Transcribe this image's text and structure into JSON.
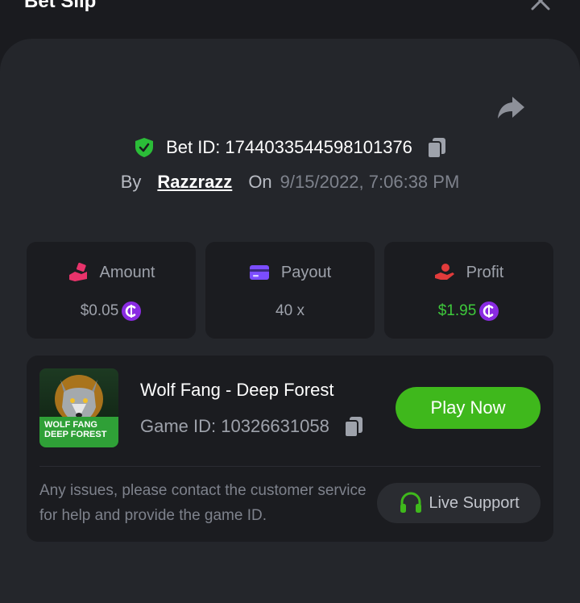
{
  "header": {
    "title": "Bet Slip",
    "close_icon": "close-icon"
  },
  "bet": {
    "id_text": "Bet ID: 1744033544598101376",
    "by_label": "By",
    "username": "Razzrazz",
    "on_label": "On",
    "date": "9/15/2022, 7:06:38 PM"
  },
  "stats": {
    "amount": {
      "label": "Amount",
      "value": "$0.05",
      "icon": "bet-hand-icon"
    },
    "payout": {
      "label": "Payout",
      "value": "40 x",
      "icon": "card-icon"
    },
    "profit": {
      "label": "Profit",
      "value": "$1.95",
      "icon": "money-hand-icon"
    }
  },
  "game": {
    "name": "Wolf Fang - Deep Forest",
    "id_text": "Game ID: 10326631058",
    "thumb_line1": "WOLF FANG",
    "thumb_line2": "DEEP FOREST",
    "play_label": "Play Now"
  },
  "support": {
    "help_text": "Any issues, please contact the customer service for help and provide the game ID.",
    "button_label": "Live Support"
  },
  "colors": {
    "accent_green": "#3fb81c",
    "profit_green": "#3ec93b",
    "coin_purple": "#8a2be2",
    "amount_pink": "#e8336b",
    "payout_purple": "#7b4dff",
    "profit_red": "#e23b3b"
  }
}
